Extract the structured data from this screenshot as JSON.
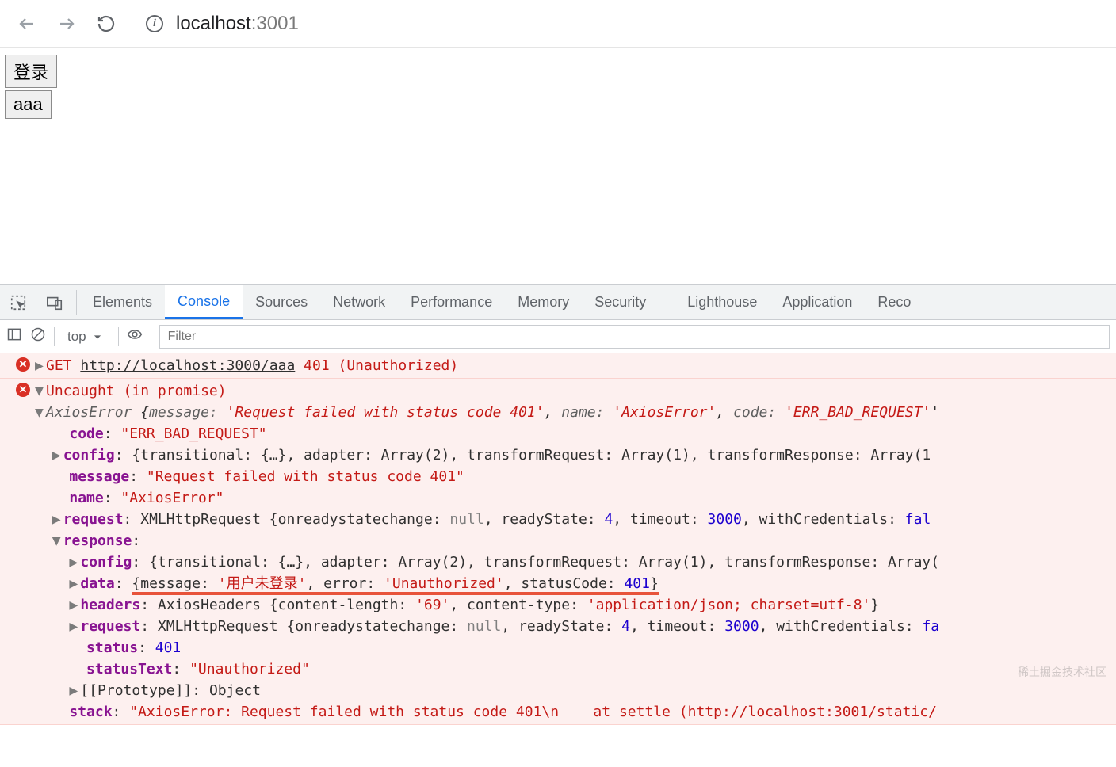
{
  "addressBar": {
    "host": "localhost",
    "port": ":3001"
  },
  "page": {
    "btn1": "登录",
    "btn2": "aaa"
  },
  "devtools": {
    "tabs": [
      "Elements",
      "Console",
      "Sources",
      "Network",
      "Performance",
      "Memory",
      "Security",
      "Lighthouse",
      "Application",
      "Reco"
    ],
    "activeTab": "Console",
    "contextSelect": "top",
    "filterPlaceholder": "Filter"
  },
  "console": {
    "line1": {
      "method": "GET",
      "url": "http://localhost:3000/aaa",
      "status": "401 (Unauthorized)"
    },
    "uncaught": "Uncaught (in promise)",
    "axiosSummary": {
      "type": "AxiosError ",
      "open": "{",
      "k_message": "message:",
      "v_message": "'Request failed with status code 401'",
      "k_name": "name:",
      "v_name": "'AxiosError'",
      "k_code": "code:",
      "v_code": "'ERR_BAD_REQUEST'"
    },
    "props": {
      "code_k": "code",
      "code_v": "\"ERR_BAD_REQUEST\"",
      "config_k": "config",
      "config_v": "{transitional: {…}, adapter: Array(2), transformRequest: Array(1), transformResponse: Array(1",
      "message_k": "message",
      "message_v": "\"Request failed with status code 401\"",
      "name_k": "name",
      "name_v": "\"AxiosError\"",
      "request_k": "request",
      "request_v_pre": "XMLHttpRequest {onreadystatechange: ",
      "null": "null",
      "request_v_mid": ", readyState: ",
      "readyState": "4",
      "timeout_l": ", timeout: ",
      "timeout": "3000",
      "withCred_l": ", withCredentials: ",
      "withCred": "fal",
      "response_k": "response"
    },
    "response": {
      "config_k": "config",
      "config_v": "{transitional: {…}, adapter: Array(2), transformRequest: Array(1), transformResponse: Array(",
      "data_k": "data",
      "data_open": "{message: ",
      "data_msg": "'用户未登录'",
      "data_err_l": ", error: ",
      "data_err": "'Unauthorized'",
      "data_sc_l": ", statusCode: ",
      "data_sc": "401",
      "data_close": "}",
      "headers_k": "headers",
      "headers_v_pre": "AxiosHeaders {content-length: ",
      "headers_cl": "'69'",
      "headers_ct_l": ", content-type: ",
      "headers_ct": "'application/json; charset=utf-8'",
      "headers_close": "}",
      "request_k": "request",
      "request_tail": "fa",
      "status_k": "status",
      "status_v": "401",
      "statusText_k": "statusText",
      "statusText_v": "\"Unauthorized\"",
      "proto_k": "[[Prototype]]",
      "proto_v": "Object"
    },
    "stack": {
      "k": "stack",
      "v": "\"AxiosError: Request failed with status code 401\\n    at settle (http://localhost:3001/static/"
    }
  },
  "watermark": "稀土掘金技术社区"
}
